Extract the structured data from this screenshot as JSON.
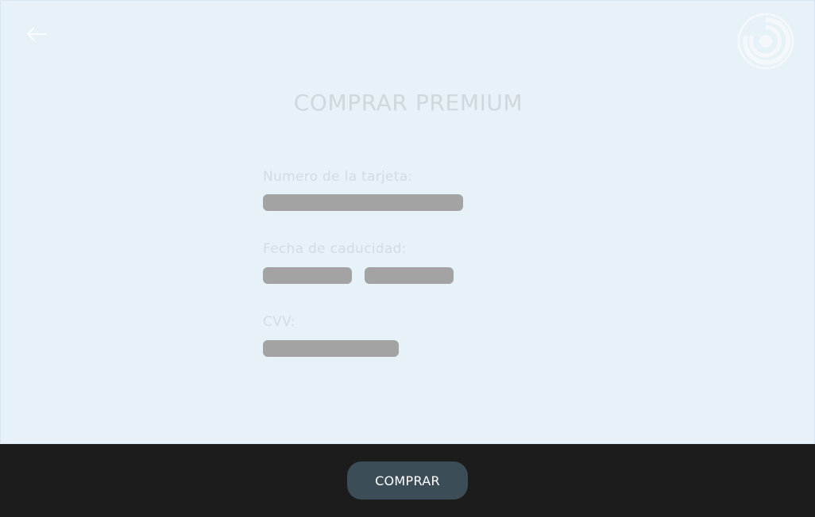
{
  "header": {
    "back_icon": "arrow-left-icon",
    "logo_icon": "spiral-logo-icon"
  },
  "page": {
    "title": "COMPRAR PREMIUM"
  },
  "form": {
    "card_number_label": "Numero de la tarjeta:",
    "card_number_value": "",
    "expiry_label": "Fecha de caducidad:",
    "expiry_month_value": "",
    "expiry_year_value": "",
    "cvv_label": "CVV:",
    "cvv_value": ""
  },
  "footer": {
    "buy_label": "COMPRAR"
  },
  "colors": {
    "background": "#e6f1f8",
    "footer": "#1c1c1c",
    "button": "#3d4d58",
    "field": "#a3a3a3",
    "faded_text": "#d0d7dd"
  }
}
